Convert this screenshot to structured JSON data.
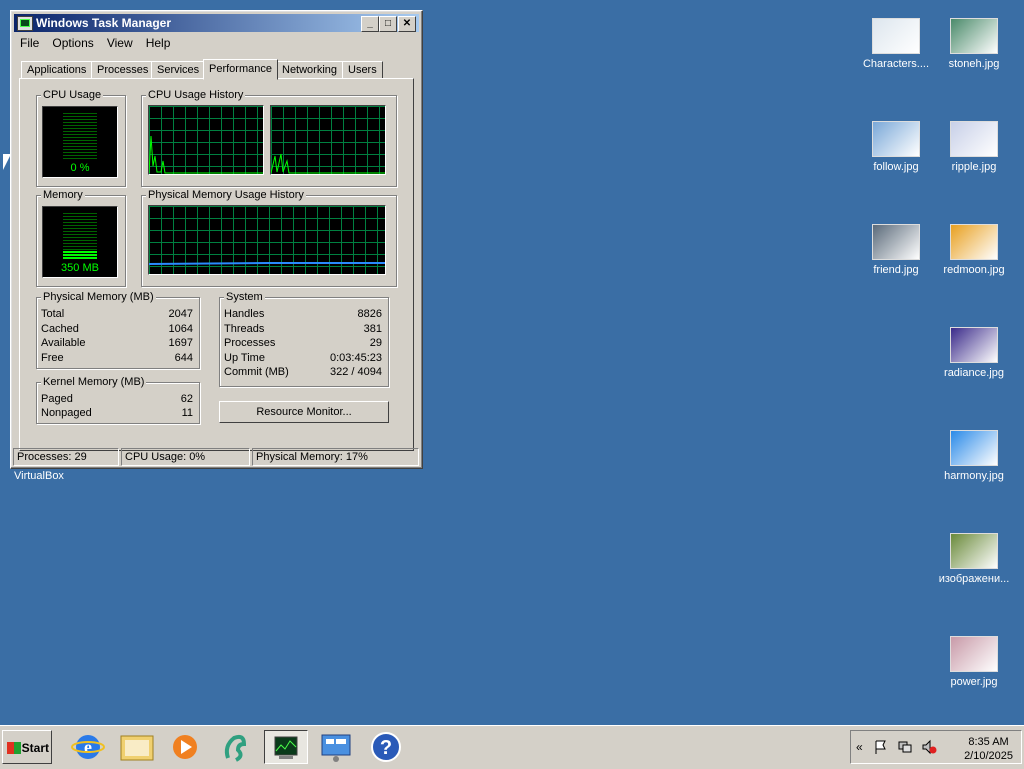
{
  "window": {
    "title": "Windows Task Manager",
    "buttons": {
      "minimize": "_",
      "maximize": "□",
      "close": "✕"
    },
    "menu": [
      "File",
      "Options",
      "View",
      "Help"
    ],
    "tabs": [
      "Applications",
      "Processes",
      "Services",
      "Performance",
      "Networking",
      "Users"
    ],
    "active_tab": "Performance"
  },
  "performance": {
    "cpu_usage": {
      "label": "CPU Usage",
      "value": "0 %",
      "level": 0
    },
    "cpu_history": {
      "label": "CPU Usage History"
    },
    "memory": {
      "label": "Memory",
      "value": "350 MB",
      "level": 0.17
    },
    "memory_history": {
      "label": "Physical Memory Usage History"
    },
    "physical_memory": {
      "label": "Physical Memory (MB)",
      "rows": [
        {
          "k": "Total",
          "v": "2047"
        },
        {
          "k": "Cached",
          "v": "1064"
        },
        {
          "k": "Available",
          "v": "1697"
        },
        {
          "k": "Free",
          "v": "644"
        }
      ]
    },
    "kernel_memory": {
      "label": "Kernel Memory (MB)",
      "rows": [
        {
          "k": "Paged",
          "v": "62"
        },
        {
          "k": "Nonpaged",
          "v": "11"
        }
      ]
    },
    "system": {
      "label": "System",
      "rows": [
        {
          "k": "Handles",
          "v": "8826"
        },
        {
          "k": "Threads",
          "v": "381"
        },
        {
          "k": "Processes",
          "v": "29"
        },
        {
          "k": "Up Time",
          "v": "0:03:45:23"
        },
        {
          "k": "Commit (MB)",
          "v": "322 / 4094"
        }
      ]
    },
    "resource_monitor_button": "Resource Monitor..."
  },
  "status_bar": {
    "processes": "Processes: 29",
    "cpu": "CPU Usage: 0%",
    "memory": "Physical Memory: 17%"
  },
  "window_caption": "VirtualBox",
  "desktop_icons": [
    {
      "label": "Characters....",
      "color": "#dde6ee"
    },
    {
      "label": "stoneh.jpg",
      "color": "#4a8a6a"
    },
    {
      "label": "follow.jpg",
      "color": "#7aa8d8"
    },
    {
      "label": "ripple.jpg",
      "color": "#c8d0e8"
    },
    {
      "label": "friend.jpg",
      "color": "#5a6a7a"
    },
    {
      "label": "redmoon.jpg",
      "color": "#e8a020"
    },
    {
      "label": "radiance.jpg",
      "color": "#3a2a8a"
    },
    {
      "label": "harmony.jpg",
      "color": "#2a8ae8"
    },
    {
      "label": "изображени...",
      "color": "#6a8a3a"
    },
    {
      "label": "power.jpg",
      "color": "#c89aa8"
    }
  ],
  "taskbar": {
    "start_label": "Start",
    "clock_time": "8:35 AM",
    "clock_date": "2/10/2025",
    "tray_chevron": "«"
  },
  "colors": {
    "desktop": "#3a6ea5",
    "graph_line": "#00ff00",
    "memory_line": "#2a8aff"
  }
}
